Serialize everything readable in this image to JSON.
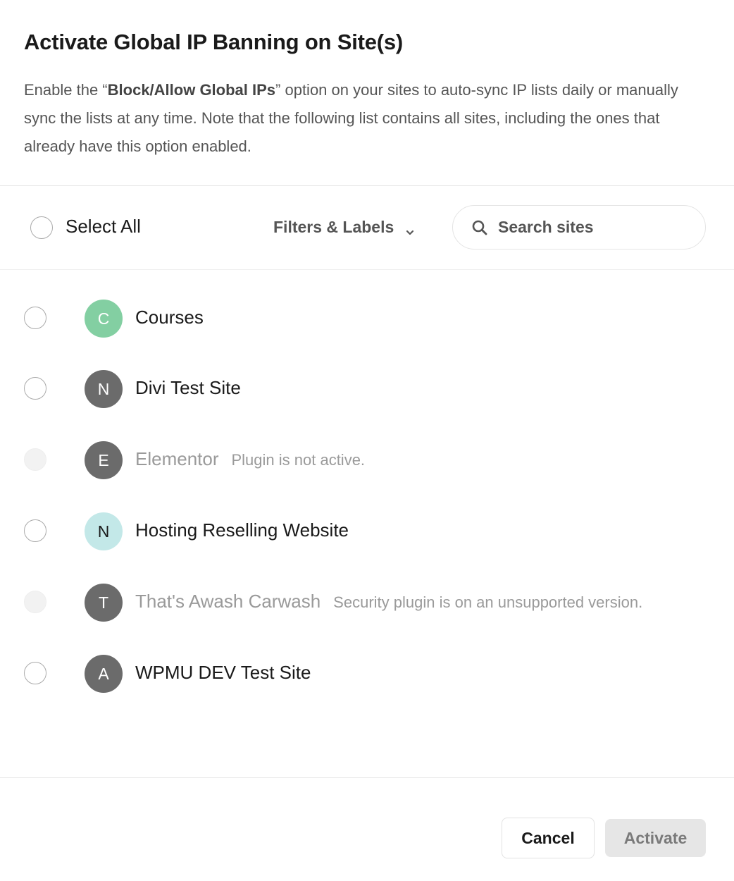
{
  "modal": {
    "title": "Activate Global IP Banning on Site(s)",
    "description": {
      "prefix": "Enable the “",
      "bold": "Block/Allow Global IPs",
      "suffix": "” option on your sites to auto-sync IP lists daily or manually sync the lists at any time. Note that the following list contains all sites, including the ones that already have this option enabled."
    }
  },
  "toolbar": {
    "select_all_label": "Select All",
    "select_all_checked": false,
    "filters_label": "Filters & Labels",
    "filters_icon": "chevron-down-icon",
    "search_icon": "search-icon",
    "search_placeholder": "Search sites",
    "search_value": ""
  },
  "sites": [
    {
      "initial": "C",
      "name": "Courses",
      "note": "",
      "disabled": false,
      "checked": false,
      "avatar_color": "#83CFA2",
      "avatar_text_color": "#FFFFFF"
    },
    {
      "initial": "N",
      "name": "Divi Test Site",
      "note": "",
      "disabled": false,
      "checked": false,
      "avatar_color": "#6B6B6B",
      "avatar_text_color": "#FFFFFF"
    },
    {
      "initial": "E",
      "name": "Elementor",
      "note": "Plugin is not active.",
      "disabled": true,
      "checked": false,
      "avatar_color": "#6B6B6B",
      "avatar_text_color": "#FFFFFF"
    },
    {
      "initial": "N",
      "name": "Hosting Reselling Website",
      "note": "",
      "disabled": false,
      "checked": false,
      "avatar_color": "#C3E8E8",
      "avatar_text_color": "#1A1A1A"
    },
    {
      "initial": "T",
      "name": "That's Awash Carwash",
      "note": "Security plugin is on an unsupported version.",
      "disabled": true,
      "checked": false,
      "avatar_color": "#6B6B6B",
      "avatar_text_color": "#FFFFFF"
    },
    {
      "initial": "A",
      "name": "WPMU DEV Test Site",
      "note": "",
      "disabled": false,
      "checked": false,
      "avatar_color": "#6B6B6B",
      "avatar_text_color": "#FFFFFF"
    }
  ],
  "footer": {
    "cancel_label": "Cancel",
    "activate_label": "Activate",
    "activate_disabled": true
  }
}
